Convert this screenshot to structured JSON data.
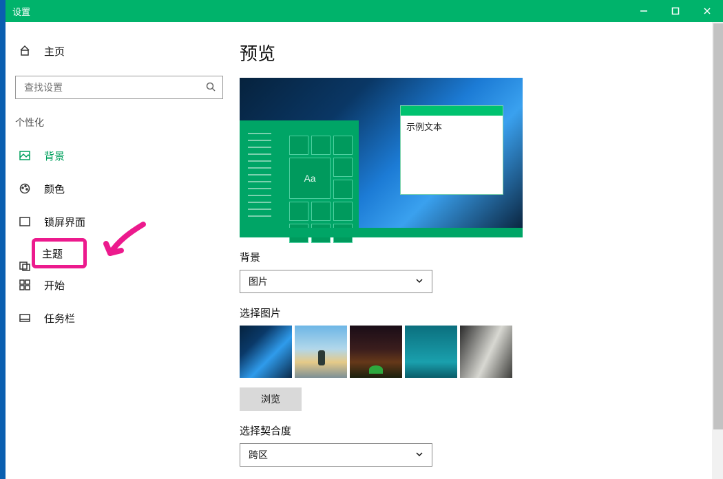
{
  "window": {
    "title": "设置"
  },
  "sidebar": {
    "home": "主页",
    "search_placeholder": "查找设置",
    "section": "个性化",
    "items": [
      {
        "id": "background",
        "label": "背景",
        "selected": true
      },
      {
        "id": "color",
        "label": "颜色"
      },
      {
        "id": "lockscreen",
        "label": "锁屏界面"
      },
      {
        "id": "themes",
        "label": "主题",
        "highlighted": true
      },
      {
        "id": "start",
        "label": "开始"
      },
      {
        "id": "taskbar",
        "label": "任务栏"
      }
    ]
  },
  "content": {
    "heading": "预览",
    "sample_text": "示例文本",
    "tile_text": "Aa",
    "bg_label": "背景",
    "bg_value": "图片",
    "pick_label": "选择图片",
    "browse_label": "浏览",
    "fit_label": "选择契合度",
    "fit_value": "跨区"
  },
  "colors": {
    "accent": "#00b36b",
    "annotation": "#ec1a8d"
  }
}
